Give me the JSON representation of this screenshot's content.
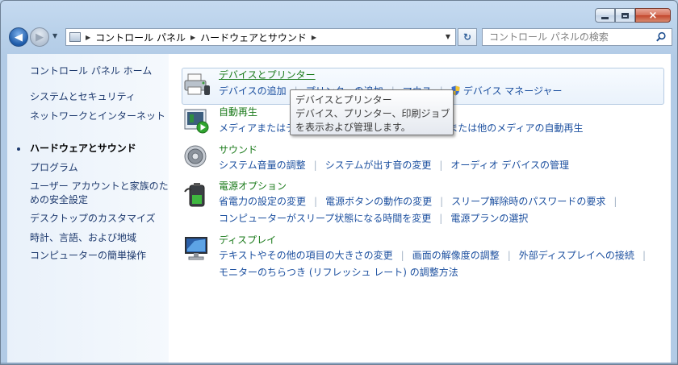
{
  "window": {
    "buttons": {
      "minimize": "minimize",
      "maximize": "maximize",
      "close": "×"
    }
  },
  "nav": {
    "breadcrumbs": [
      "コントロール パネル",
      "ハードウェアとサウンド"
    ],
    "search_placeholder": "コントロール パネルの検索"
  },
  "sidebar": {
    "items": [
      {
        "label": "コントロール パネル ホーム"
      },
      {
        "label": "システムとセキュリティ"
      },
      {
        "label": "ネットワークとインターネット"
      },
      {
        "label": "ハードウェアとサウンド",
        "current": true
      },
      {
        "label": "プログラム"
      },
      {
        "label": "ユーザー アカウントと家族のための安全設定"
      },
      {
        "label": "デスクトップのカスタマイズ"
      },
      {
        "label": "時計、言語、および地域"
      },
      {
        "label": "コンピューターの簡単操作"
      }
    ]
  },
  "categories": {
    "devices": {
      "title": "デバイスとプリンター",
      "links": [
        "デバイスの追加",
        "プリンターの追加",
        "マウス",
        "デバイス マネージャー"
      ]
    },
    "autoplay": {
      "title": "自動再生",
      "links": [
        "メディアまたはデバイスの既定の動作の変更",
        "CD または他のメディアの自動再生"
      ]
    },
    "sound": {
      "title": "サウンド",
      "links": [
        "システム音量の調整",
        "システムが出す音の変更",
        "オーディオ デバイスの管理"
      ]
    },
    "power": {
      "title": "電源オプション",
      "links": [
        "省電力の設定の変更",
        "電源ボタンの動作の変更",
        "スリープ解除時のパスワードの要求"
      ],
      "links2": [
        "コンピューターがスリープ状態になる時間を変更",
        "電源プランの選択"
      ]
    },
    "display": {
      "title": "ディスプレイ",
      "links": [
        "テキストやその他の項目の大きさの変更",
        "画面の解像度の調整",
        "外部ディスプレイへの接続"
      ],
      "links2": [
        "モニターのちらつき (リフレッシュ レート) の調整方法"
      ]
    }
  },
  "tooltip": {
    "line1": "デバイスとプリンター",
    "line2": "デバイス、プリンター、印刷ジョブ",
    "line3": "を表示および管理します。"
  },
  "colors": {
    "link": "#1b4f9f",
    "category_title": "#1a7a1a"
  }
}
